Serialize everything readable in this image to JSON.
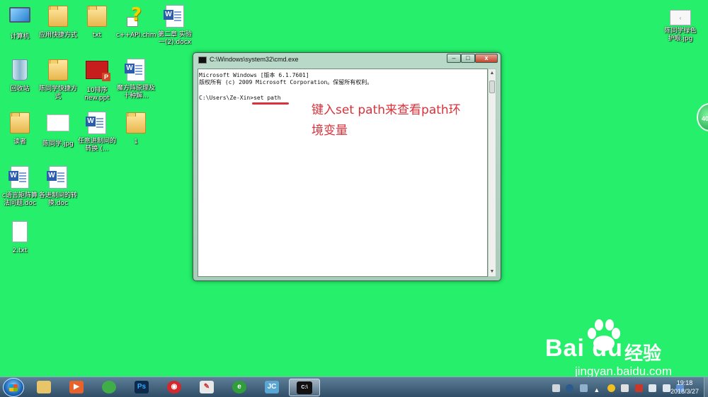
{
  "desktop_icons": [
    {
      "label": "计算机"
    },
    {
      "label": "应用快捷方式"
    },
    {
      "label": "txt"
    },
    {
      "label": "c++API.chm"
    },
    {
      "label": "第二章 实验一(2).docx"
    },
    {
      "label": "回收站"
    },
    {
      "label": "陈同学快捷方式"
    },
    {
      "label": "10排序new.ppt"
    },
    {
      "label": "魔方阵原理及十种解..."
    },
    {
      "label": "读者"
    },
    {
      "label": "陈同学.jpg"
    },
    {
      "label": "任意进制间的转换 (..."
    },
    {
      "label": "1"
    },
    {
      "label": "c语言矩阵算法问题.doc"
    },
    {
      "label": "各进制间的转换.doc"
    },
    {
      "label": "2.txt"
    }
  ],
  "right_icon": {
    "label": "陈同学绿色护眼.jpg"
  },
  "gadget": {
    "label": "40"
  },
  "cmd_window": {
    "title": "C:\\Windows\\system32\\cmd.exe",
    "min_label": "–",
    "max_label": "□",
    "close_label": "x",
    "lines": [
      "Microsoft Windows [版本 6.1.7601]",
      "版权所有 (c) 2009 Microsoft Corporation。保留所有权利。",
      "",
      "C:\\Users\\Ze-Xin>set path"
    ]
  },
  "annotation": {
    "line1": "键入set path来查看path环",
    "line2": "境变量"
  },
  "watermark": {
    "brand": "Bai  du",
    "cn": "经验",
    "url": "jingyan.baidu.com"
  },
  "taskbar": {
    "apps": [
      {
        "name": "explorer",
        "glyph": "",
        "color": "#e9c56a"
      },
      {
        "name": "media-player",
        "glyph": "▶",
        "color": "#e8622b"
      },
      {
        "name": "360-browser",
        "glyph": "",
        "color": "#3fae49"
      },
      {
        "name": "photoshop",
        "glyph": "Ps",
        "color": "#0d2a4d"
      },
      {
        "name": "netease-music",
        "glyph": "◉",
        "color": "#d2282e"
      },
      {
        "name": "notepad",
        "glyph": "✎",
        "color": "#e8e8e8"
      },
      {
        "name": "ie-browser",
        "glyph": "e",
        "color": "#2f9e3b"
      },
      {
        "name": "jcreator",
        "glyph": "JC",
        "color": "#5aa7d6"
      },
      {
        "name": "cmd",
        "glyph": "C:\\",
        "color": "#111111"
      }
    ],
    "time": "19:18",
    "date": "2018/3/27"
  }
}
